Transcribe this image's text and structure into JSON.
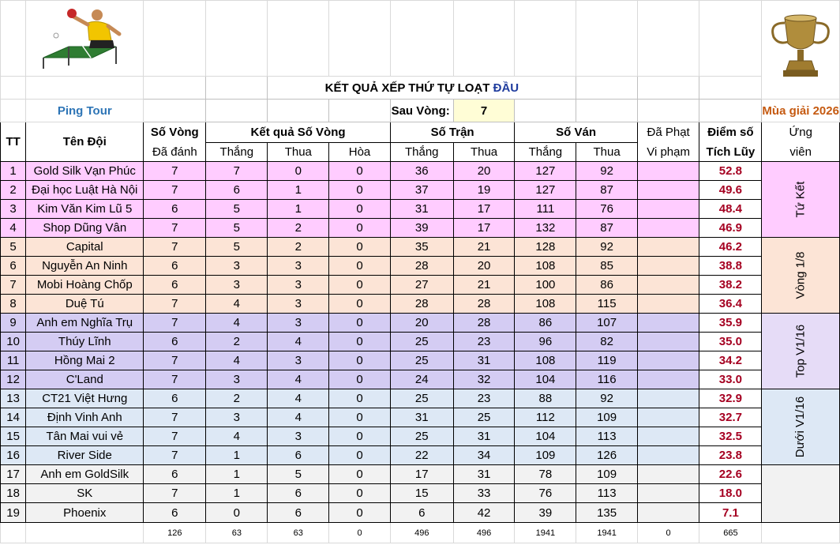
{
  "sheet": {
    "title_main": "KẾT QUẢ XẾP THỨ TỰ LOẠT",
    "title_accent": "ĐẦU",
    "after_round_label": "Sau Vòng:",
    "after_round_value": "7",
    "brand": "Ping Tour",
    "season": "Mùa giải 2026"
  },
  "headers": {
    "tt": "TT",
    "team": "Tên Đội",
    "rounds_top": "Số Vòng",
    "rounds_bot": "Đã đánh",
    "round_results": "Kết quả Số Vòng",
    "matches": "Số Trận",
    "games": "Số Ván",
    "penalty_top": "Đã Phạt",
    "penalty_bot": "Vi phạm",
    "points_top": "Điểm số",
    "points_bot": "Tích Lũy",
    "cand_top": "Ứng",
    "cand_bot": "viên",
    "win": "Thắng",
    "loss": "Thua",
    "draw": "Hòa"
  },
  "rows": [
    {
      "tt": "1",
      "team": "Gold Silk Vạn Phúc",
      "played": "7",
      "w": "7",
      "l": "0",
      "d": "0",
      "mw": "36",
      "ml": "20",
      "gw": "127",
      "gl": "92",
      "pen": "",
      "pts": "52.8"
    },
    {
      "tt": "2",
      "team": "Đại học Luật Hà Nội",
      "played": "7",
      "w": "6",
      "l": "1",
      "d": "0",
      "mw": "37",
      "ml": "19",
      "gw": "127",
      "gl": "87",
      "pen": "",
      "pts": "49.6"
    },
    {
      "tt": "3",
      "team": "Kim Văn Kim Lũ 5",
      "played": "6",
      "w": "5",
      "l": "1",
      "d": "0",
      "mw": "31",
      "ml": "17",
      "gw": "111",
      "gl": "76",
      "pen": "",
      "pts": "48.4"
    },
    {
      "tt": "4",
      "team": "Shop Dũng Vân",
      "played": "7",
      "w": "5",
      "l": "2",
      "d": "0",
      "mw": "39",
      "ml": "17",
      "gw": "132",
      "gl": "87",
      "pen": "",
      "pts": "46.9"
    },
    {
      "tt": "5",
      "team": "Capital",
      "played": "7",
      "w": "5",
      "l": "2",
      "d": "0",
      "mw": "35",
      "ml": "21",
      "gw": "128",
      "gl": "92",
      "pen": "",
      "pts": "46.2"
    },
    {
      "tt": "6",
      "team": "Nguyễn An Ninh",
      "played": "6",
      "w": "3",
      "l": "3",
      "d": "0",
      "mw": "28",
      "ml": "20",
      "gw": "108",
      "gl": "85",
      "pen": "",
      "pts": "38.8"
    },
    {
      "tt": "7",
      "team": "Mobi Hoàng Chốp",
      "played": "6",
      "w": "3",
      "l": "3",
      "d": "0",
      "mw": "27",
      "ml": "21",
      "gw": "100",
      "gl": "86",
      "pen": "",
      "pts": "38.2"
    },
    {
      "tt": "8",
      "team": "Duệ Tú",
      "played": "7",
      "w": "4",
      "l": "3",
      "d": "0",
      "mw": "28",
      "ml": "28",
      "gw": "108",
      "gl": "115",
      "pen": "",
      "pts": "36.4"
    },
    {
      "tt": "9",
      "team": "Anh em Nghĩa Trụ",
      "played": "7",
      "w": "4",
      "l": "3",
      "d": "0",
      "mw": "20",
      "ml": "28",
      "gw": "86",
      "gl": "107",
      "pen": "",
      "pts": "35.9"
    },
    {
      "tt": "10",
      "team": "Thúy Lĩnh",
      "played": "6",
      "w": "2",
      "l": "4",
      "d": "0",
      "mw": "25",
      "ml": "23",
      "gw": "96",
      "gl": "82",
      "pen": "",
      "pts": "35.0"
    },
    {
      "tt": "11",
      "team": "Hồng Mai 2",
      "played": "7",
      "w": "4",
      "l": "3",
      "d": "0",
      "mw": "25",
      "ml": "31",
      "gw": "108",
      "gl": "119",
      "pen": "",
      "pts": "34.2"
    },
    {
      "tt": "12",
      "team": "C'Land",
      "played": "7",
      "w": "3",
      "l": "4",
      "d": "0",
      "mw": "24",
      "ml": "32",
      "gw": "104",
      "gl": "116",
      "pen": "",
      "pts": "33.0"
    },
    {
      "tt": "13",
      "team": "CT21 Việt Hưng",
      "played": "6",
      "w": "2",
      "l": "4",
      "d": "0",
      "mw": "25",
      "ml": "23",
      "gw": "88",
      "gl": "92",
      "pen": "",
      "pts": "32.9"
    },
    {
      "tt": "14",
      "team": "Định Vinh Anh",
      "played": "7",
      "w": "3",
      "l": "4",
      "d": "0",
      "mw": "31",
      "ml": "25",
      "gw": "112",
      "gl": "109",
      "pen": "",
      "pts": "32.7"
    },
    {
      "tt": "15",
      "team": "Tân Mai vui vẻ",
      "played": "7",
      "w": "4",
      "l": "3",
      "d": "0",
      "mw": "25",
      "ml": "31",
      "gw": "104",
      "gl": "113",
      "pen": "",
      "pts": "32.5"
    },
    {
      "tt": "16",
      "team": "River Side",
      "played": "7",
      "w": "1",
      "l": "6",
      "d": "0",
      "mw": "22",
      "ml": "34",
      "gw": "109",
      "gl": "126",
      "pen": "",
      "pts": "23.8"
    },
    {
      "tt": "17",
      "team": "Anh em GoldSilk",
      "played": "6",
      "w": "1",
      "l": "5",
      "d": "0",
      "mw": "17",
      "ml": "31",
      "gw": "78",
      "gl": "109",
      "pen": "",
      "pts": "22.6"
    },
    {
      "tt": "18",
      "team": "SK",
      "played": "7",
      "w": "1",
      "l": "6",
      "d": "0",
      "mw": "15",
      "ml": "33",
      "gw": "76",
      "gl": "113",
      "pen": "",
      "pts": "18.0"
    },
    {
      "tt": "19",
      "team": "Phoenix",
      "played": "6",
      "w": "0",
      "l": "6",
      "d": "0",
      "mw": "6",
      "ml": "42",
      "gw": "39",
      "gl": "135",
      "pen": "",
      "pts": "7.1"
    }
  ],
  "groups": [
    {
      "label": "Tứ Kết"
    },
    {
      "label": "Vòng 1/8"
    },
    {
      "label": "Top V1/16"
    },
    {
      "label": "Dưới V1/16"
    }
  ],
  "totals": {
    "played": "126",
    "w": "63",
    "l": "63",
    "d": "0",
    "mw": "496",
    "ml": "496",
    "gw": "1941",
    "gl": "1941",
    "pen": "0",
    "pts": "665"
  },
  "colors": {
    "group_quarter": "#ffccff",
    "group_r16": "#fce4d6",
    "group_top_r32": "#d4ccf3",
    "group_below_r32": "#dde8f5",
    "group_rest": "#f2f2f2",
    "points_text": "#a50021",
    "brand_text": "#2e75b6",
    "season_text": "#c55a11"
  }
}
